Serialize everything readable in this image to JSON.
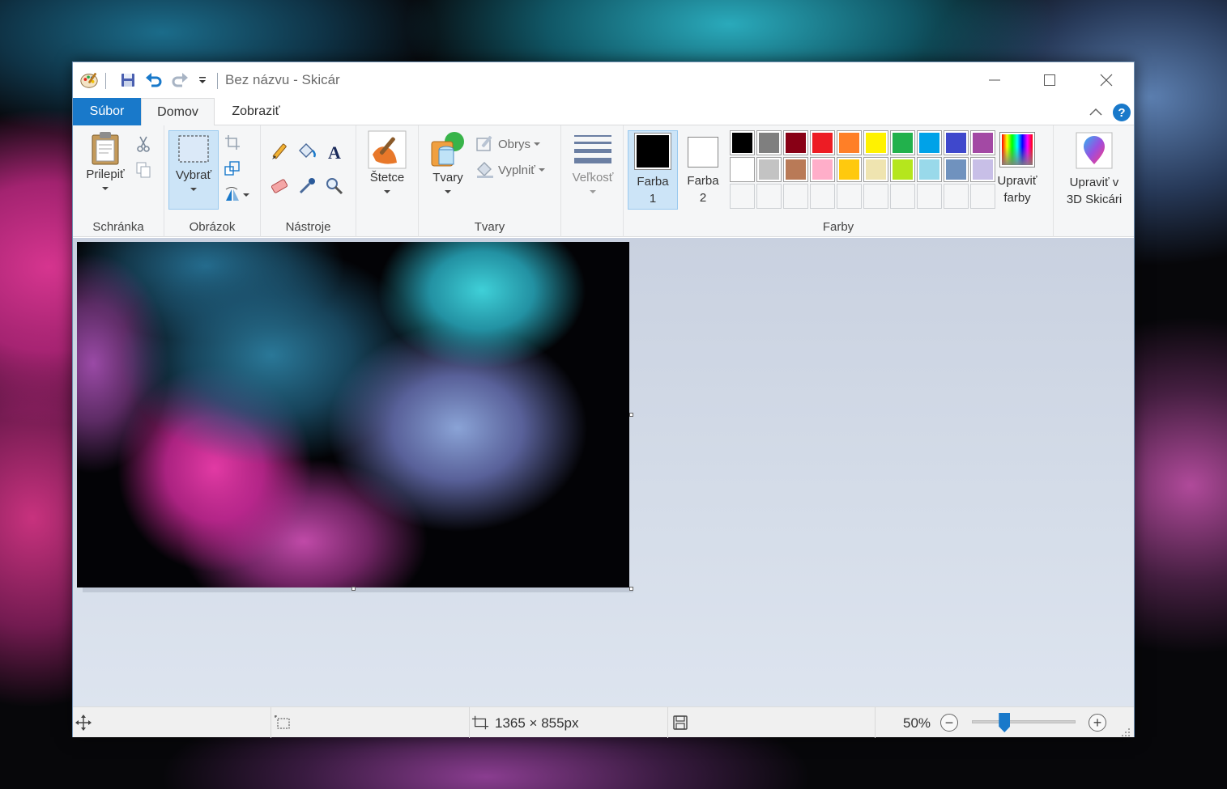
{
  "window": {
    "title": "Bez názvu - Skicár"
  },
  "tabs": {
    "file": "Súbor",
    "home": "Domov",
    "view": "Zobraziť",
    "help": "?"
  },
  "ribbon": {
    "clipboard": {
      "label": "Schránka",
      "paste": "Prilepiť"
    },
    "image": {
      "label": "Obrázok",
      "select": "Vybrať"
    },
    "tools": {
      "label": "Nástroje"
    },
    "brushes": {
      "label": "Štetce"
    },
    "shapes": {
      "label": "Tvary",
      "shapes_btn": "Tvary",
      "outline": "Obrys",
      "fill": "Vyplniť"
    },
    "size": {
      "label": "Veľkosť"
    },
    "colors": {
      "label": "Farby",
      "color1_line1": "Farba",
      "color1_line2": "1",
      "color2_line1": "Farba",
      "color2_line2": "2",
      "color1_value": "#000000",
      "color2_value": "#ffffff",
      "edit_line1": "Upraviť",
      "edit_line2": "farby",
      "palette_row1": [
        "#000000",
        "#7f7f7f",
        "#880015",
        "#ed1c24",
        "#ff7f27",
        "#fff200",
        "#22b14c",
        "#00a2e8",
        "#3f48cc",
        "#a349a4"
      ],
      "palette_row2": [
        "#ffffff",
        "#c3c3c3",
        "#b97a57",
        "#ffaec9",
        "#ffc90e",
        "#efe4b0",
        "#b5e61d",
        "#99d9ea",
        "#7092be",
        "#c8bfe7"
      ],
      "custom_count": 10
    },
    "paint3d": {
      "line1": "Upraviť v",
      "line2": "3D Skicári"
    }
  },
  "status": {
    "image_size": "1365 × 855px",
    "zoom": "50%",
    "zoom_level_percent": 50
  },
  "accent_color": "#1979ca"
}
